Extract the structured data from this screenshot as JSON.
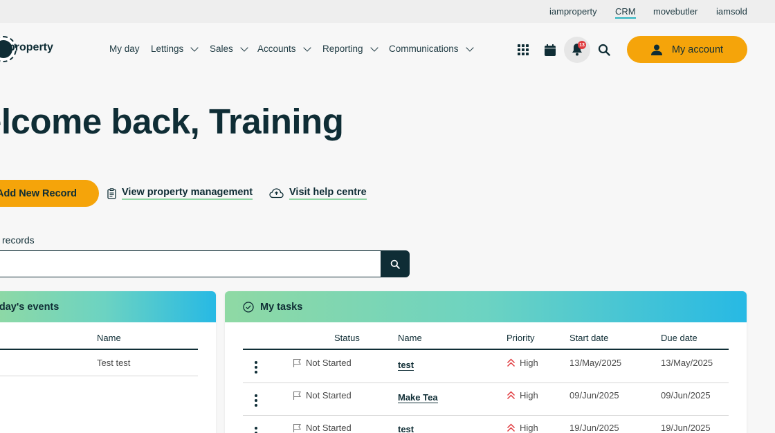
{
  "topbar": {
    "links": [
      "iamproperty",
      "CRM",
      "movebutler",
      "iamsold"
    ],
    "active": "CRM"
  },
  "brand": {
    "logo_text": "property"
  },
  "nav": {
    "my_day": "My day",
    "lettings": "Lettings",
    "sales": "Sales",
    "accounts": "Accounts",
    "reporting": "Reporting",
    "communications": "Communications"
  },
  "header": {
    "notifications_count": "13",
    "account_label": "My account"
  },
  "colors": {
    "brand_orange": "#f5a40a",
    "dark": "#0f2d35",
    "accent_green": "#8fd6a4",
    "accent_blue": "#27b9e4",
    "badge_red": "#e03a3e"
  },
  "welcome": {
    "title": "elcome back, Training"
  },
  "actions": {
    "add_record": "Add New Record",
    "view_property_management": "View property management",
    "visit_help_centre": "Visit help centre"
  },
  "search": {
    "label": "l records",
    "value": ""
  },
  "events": {
    "title": "oday's events",
    "columns": {
      "name": "Name"
    },
    "rows": [
      {
        "name": "Test test"
      }
    ]
  },
  "tasks": {
    "title": "My tasks",
    "columns": {
      "status": "Status",
      "name": "Name",
      "priority": "Priority",
      "start": "Start date",
      "due": "Due date"
    },
    "rows": [
      {
        "status": "Not Started",
        "name": "test",
        "priority": "High",
        "start": "13/May/2025",
        "due": "13/May/2025"
      },
      {
        "status": "Not Started",
        "name": "Make Tea",
        "priority": "High",
        "start": "09/Jun/2025",
        "due": "09/Jun/2025"
      },
      {
        "status": "Not Started",
        "name": "test",
        "priority": "High",
        "start": "19/Jun/2025",
        "due": "19/Jun/2025"
      }
    ]
  }
}
